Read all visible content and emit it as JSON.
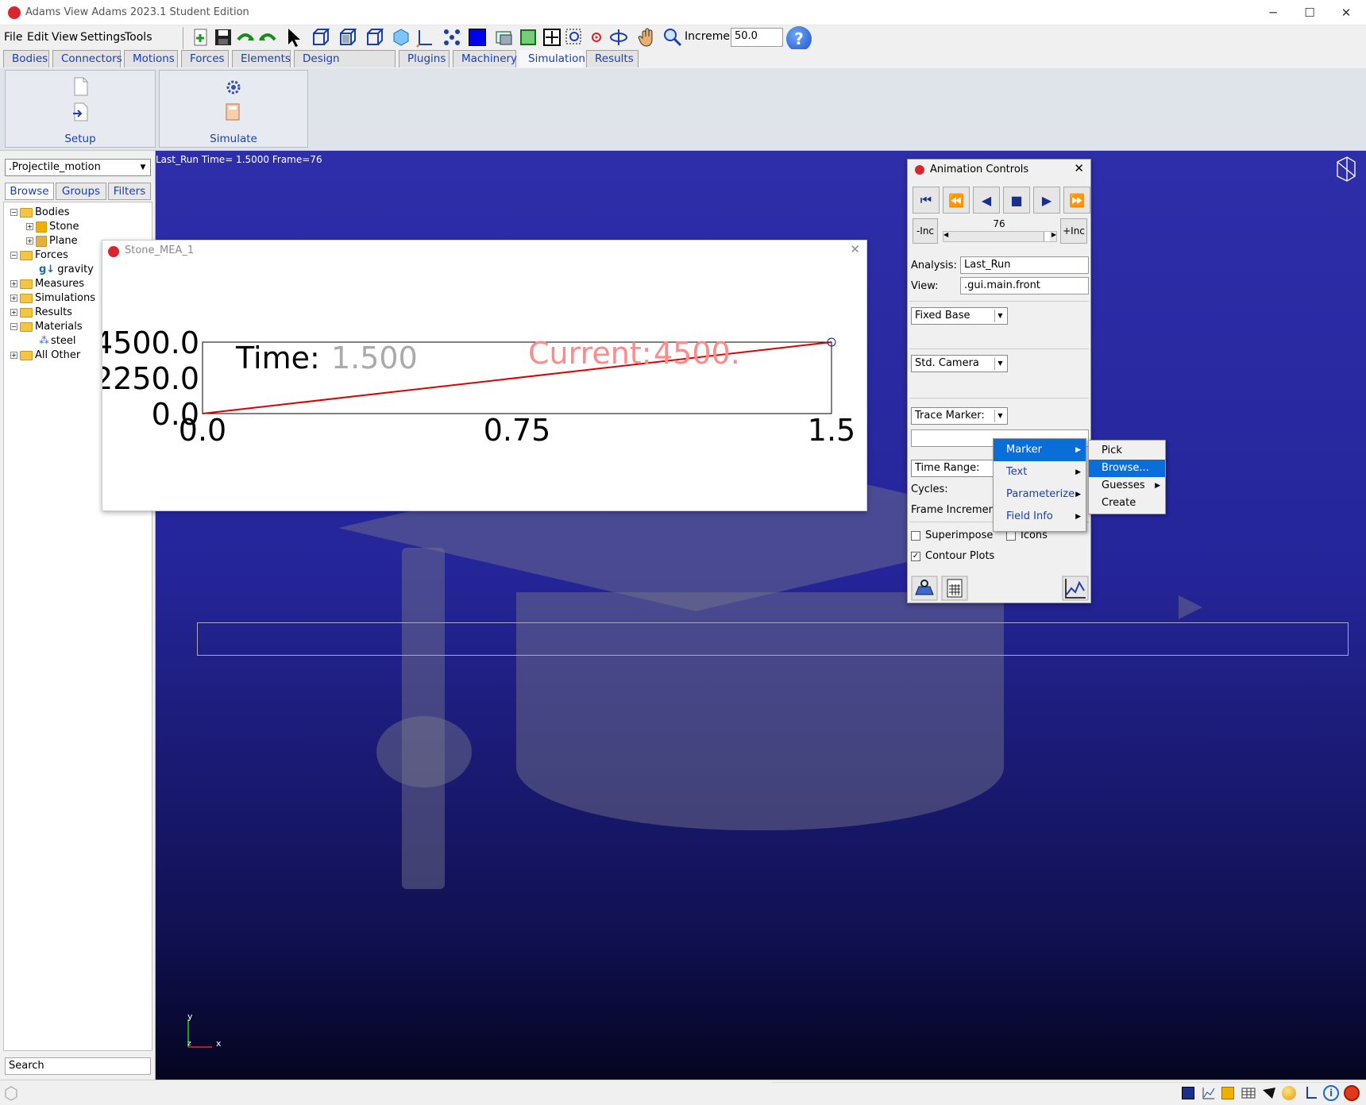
{
  "window": {
    "title": "Adams  View Adams 2023.1 Student Edition",
    "controls": [
      "─",
      "☐",
      "✕"
    ]
  },
  "menu": [
    "File",
    "Edit",
    "View",
    "Settings",
    "Tools"
  ],
  "toolbar": {
    "increment_label": "Increment",
    "increment_value": "50.0",
    "help": "?"
  },
  "tabs": [
    "Bodies",
    "Connectors",
    "Motions",
    "Forces",
    "Elements",
    "Design Exploration",
    "Plugins",
    "Machinery",
    "Simulation",
    "Results"
  ],
  "active_tab": "Simulation",
  "ribbon": {
    "groups": [
      "Setup",
      "Simulate"
    ]
  },
  "left_panel": {
    "model": ".Projectile_motion",
    "tabs": [
      "Browse",
      "Groups",
      "Filters"
    ],
    "tree": [
      {
        "label": "Bodies",
        "level": 0
      },
      {
        "label": "Stone",
        "level": 1
      },
      {
        "label": "Plane",
        "level": 1
      },
      {
        "label": "Forces",
        "level": 0
      },
      {
        "label": "gravity",
        "level": 1
      },
      {
        "label": "Measures",
        "level": 0
      },
      {
        "label": "Simulations",
        "level": 0
      },
      {
        "label": "Results",
        "level": 0
      },
      {
        "label": "Materials",
        "level": 0
      },
      {
        "label": "steel",
        "level": 1
      },
      {
        "label": "All Other",
        "level": 0
      }
    ],
    "search": "Search"
  },
  "viewport": {
    "status": "Last_Run   Time= 1.5000  Frame=76",
    "axis_y": "y",
    "axis_x": "x",
    "axis_z": "z"
  },
  "plot_window": {
    "title": "Stone_MEA_1",
    "time_label": "Time:",
    "time_value": "1.500",
    "current_label": "Current:",
    "current_value": "4500.",
    "close": "✕"
  },
  "chart_data": {
    "type": "line",
    "x": [
      0.0,
      1.5
    ],
    "series": [
      {
        "values": [
          0.0,
          4500.0
        ],
        "color": "#e00000"
      }
    ],
    "xticks": [
      "0.0",
      "0.75",
      "1.5"
    ],
    "yticks": [
      "4500.0",
      "2250.0",
      "0.0"
    ],
    "xlim": [
      0,
      1.5
    ],
    "ylim": [
      0,
      4500
    ]
  },
  "animation_controls": {
    "title": "Animation Controls",
    "close": "✕",
    "frame": "76",
    "minus_inc": "-Inc",
    "plus_inc": "+Inc",
    "analysis_label": "Analysis:",
    "analysis_value": "Last_Run",
    "view_label": "View:",
    "view_value": ".gui.main.front",
    "base": "Fixed Base",
    "camera": "Std. Camera",
    "trace": "Trace Marker:",
    "time_range": "Time Range:",
    "cycles": "Cycles:",
    "frame_increment": "Frame Increment:",
    "superimpose": "Superimpose",
    "icons": "Icons",
    "contour": "Contour Plots"
  },
  "context_menu": {
    "items": [
      "Marker",
      "Text",
      "Parameterize",
      "Field Info"
    ],
    "highlighted": "Marker"
  },
  "submenu": {
    "items": [
      "Pick",
      "Browse...",
      "Guesses",
      "Create"
    ],
    "highlighted": "Browse..."
  },
  "colors": {
    "accent": "#1a3eb0",
    "highlight": "#0a6ed8",
    "curve": "#e00000"
  }
}
